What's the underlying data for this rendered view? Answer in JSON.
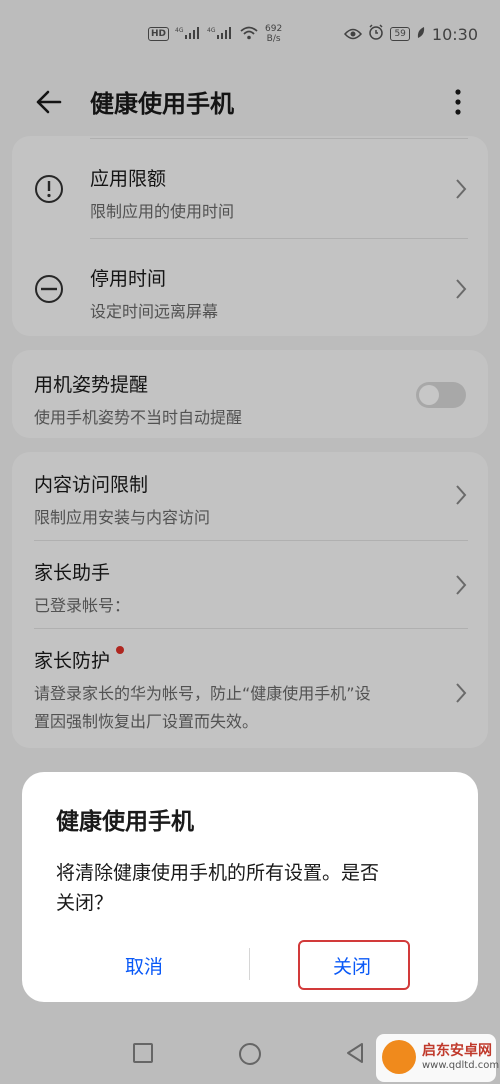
{
  "status_bar": {
    "hd_badge": "HD",
    "net1": "4G",
    "net2": "4G",
    "speed_value": "692",
    "speed_unit": "B/s",
    "battery": "59",
    "time": "10:30"
  },
  "header": {
    "title": "健康使用手机"
  },
  "sections": {
    "app_limits": {
      "title": "应用限额",
      "subtitle": "限制应用的使用时间"
    },
    "downtime": {
      "title": "停用时间",
      "subtitle": "设定时间远离屏幕"
    },
    "posture": {
      "title": "用机姿势提醒",
      "subtitle": "使用手机姿势不当时自动提醒",
      "toggle_on": false
    },
    "content_restrict": {
      "title": "内容访问限制",
      "subtitle": "限制应用安装与内容访问"
    },
    "parent_assistant": {
      "title": "家长助手",
      "subtitle": "已登录帐号："
    },
    "parent_protect": {
      "title": "家长防护",
      "subtitle_line1": "请登录家长的华为帐号，防止“健康使用手机”设",
      "subtitle_line2": "置因强制恢复出厂设置而失效。"
    }
  },
  "dialog": {
    "title": "健康使用手机",
    "message_line1": "将清除健康使用手机的所有设置。是否",
    "message_line2": "关闭？",
    "cancel_label": "取消",
    "close_label": "关闭"
  },
  "watermark": {
    "brand": "启东安卓网",
    "url": "www.qdltd.com"
  },
  "colors": {
    "accent": "#0a59f7",
    "highlight_border": "#d23a3a",
    "red_dot": "#e0322a"
  }
}
